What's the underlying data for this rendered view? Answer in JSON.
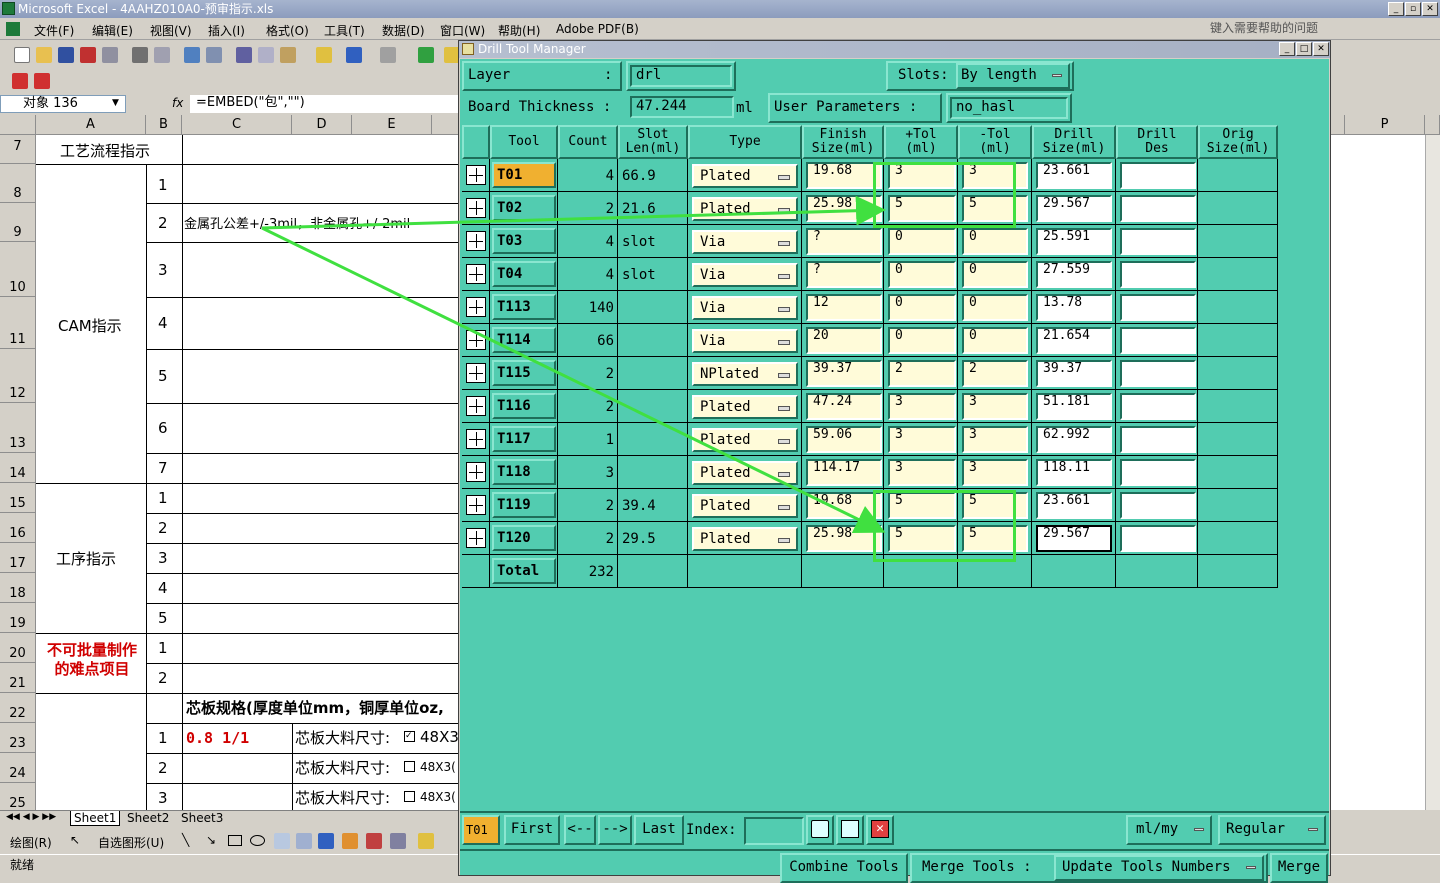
{
  "excel": {
    "window_title": "Microsoft Excel - 4AAHZ010A0-预审指示.xls",
    "menu": [
      "文件(F)",
      "编辑(E)",
      "视图(V)",
      "插入(I)",
      "格式(O)",
      "工具(T)",
      "数据(D)",
      "窗口(W)",
      "帮助(H)",
      "Adobe PDF(B)"
    ],
    "help_placeholder": "键入需要帮助的问题",
    "name_box": "对象 136",
    "fx": "fx",
    "formula": "=EMBED(\"包\",\"\")",
    "columns": [
      "A",
      "B",
      "C",
      "D",
      "E"
    ],
    "right_column": "P",
    "rows": [
      {
        "n": "7"
      },
      {
        "n": "8"
      },
      {
        "n": "9"
      },
      {
        "n": "10"
      },
      {
        "n": "11"
      },
      {
        "n": "12"
      },
      {
        "n": "13"
      },
      {
        "n": "14"
      },
      {
        "n": "15"
      },
      {
        "n": "16"
      },
      {
        "n": "17"
      },
      {
        "n": "18"
      },
      {
        "n": "19"
      },
      {
        "n": "20"
      },
      {
        "n": "21"
      },
      {
        "n": "22"
      },
      {
        "n": "23"
      },
      {
        "n": "24"
      },
      {
        "n": "25"
      }
    ],
    "cells": {
      "process_title": "工艺流程指示",
      "cam": "CAM指示",
      "cam_nums": [
        "1",
        "2",
        "3",
        "4",
        "5",
        "6",
        "7"
      ],
      "cam_row2": "金属孔公差+/-3mil，非金属孔+/-2mil",
      "procedure": "工序指示",
      "proc_nums": [
        "1",
        "2",
        "3",
        "4",
        "5"
      ],
      "nobatch": "不可批量制作的难点项目",
      "nobatch_nums": [
        "1",
        "2"
      ],
      "core_spec": "芯板规格(厚度单位mm，铜厚单位oz,",
      "core_nums": [
        "1",
        "2",
        "3"
      ],
      "core_first": "0.8 1/1",
      "core_size": "芯板大料尺寸:",
      "core_opt1": "48X3",
      "core_opt2": "48X3("
    },
    "sheets": [
      "Sheet1",
      "Sheet2",
      "Sheet3"
    ],
    "draw_label": "绘图(R)",
    "autoshape": "自选图形(U)",
    "status": "就绪"
  },
  "dtm": {
    "title": "Drill Tool Manager",
    "layer_label": "Layer",
    "layer_colon": ":",
    "layer_value": "drl",
    "slots_label": "Slots:",
    "slots_value": "By length",
    "board_thickness_label": "Board Thickness :",
    "board_thickness_value": "47.244",
    "board_thickness_unit": "ml",
    "user_params_label": "User Parameters :",
    "user_params_value": "no_hasl",
    "headers": [
      "Tool",
      "Count",
      "Slot\nLen(ml)",
      "Type",
      "Finish\nSize(ml)",
      "+Tol\n(ml)",
      "-Tol\n(ml)",
      "Drill\nSize(ml)",
      "Drill\nDes",
      "Orig\nSize(ml)"
    ],
    "tools": [
      {
        "tool": "T01",
        "count": "4",
        "slot": "66.9",
        "type": "Plated",
        "finish": "19.68",
        "ptol": "3",
        "mtol": "3",
        "drill": "23.661",
        "des": ""
      },
      {
        "tool": "T02",
        "count": "2",
        "slot": "21.6",
        "type": "Plated",
        "finish": "25.98",
        "ptol": "5",
        "mtol": "5",
        "drill": "29.567",
        "des": ""
      },
      {
        "tool": "T03",
        "count": "4",
        "slot": "slot",
        "type": "Via",
        "finish": "?",
        "ptol": "0",
        "mtol": "0",
        "drill": "25.591",
        "des": ""
      },
      {
        "tool": "T04",
        "count": "4",
        "slot": "slot",
        "type": "Via",
        "finish": "?",
        "ptol": "0",
        "mtol": "0",
        "drill": "27.559",
        "des": ""
      },
      {
        "tool": "T113",
        "count": "140",
        "slot": "",
        "type": "Via",
        "finish": "12",
        "ptol": "0",
        "mtol": "0",
        "drill": "13.78",
        "des": ""
      },
      {
        "tool": "T114",
        "count": "66",
        "slot": "",
        "type": "Via",
        "finish": "20",
        "ptol": "0",
        "mtol": "0",
        "drill": "21.654",
        "des": ""
      },
      {
        "tool": "T115",
        "count": "2",
        "slot": "",
        "type": "NPlated",
        "finish": "39.37",
        "ptol": "2",
        "mtol": "2",
        "drill": "39.37",
        "des": ""
      },
      {
        "tool": "T116",
        "count": "2",
        "slot": "",
        "type": "Plated",
        "finish": "47.24",
        "ptol": "3",
        "mtol": "3",
        "drill": "51.181",
        "des": ""
      },
      {
        "tool": "T117",
        "count": "1",
        "slot": "",
        "type": "Plated",
        "finish": "59.06",
        "ptol": "3",
        "mtol": "3",
        "drill": "62.992",
        "des": ""
      },
      {
        "tool": "T118",
        "count": "3",
        "slot": "",
        "type": "Plated",
        "finish": "114.17",
        "ptol": "3",
        "mtol": "3",
        "drill": "118.11",
        "des": ""
      },
      {
        "tool": "T119",
        "count": "2",
        "slot": "39.4",
        "type": "Plated",
        "finish": "19.68",
        "ptol": "5",
        "mtol": "5",
        "drill": "23.661",
        "des": ""
      },
      {
        "tool": "T120",
        "count": "2",
        "slot": "29.5",
        "type": "Plated",
        "finish": "25.98",
        "ptol": "5",
        "mtol": "5",
        "drill": "29.567",
        "des": ""
      }
    ],
    "total_label": "Total",
    "total_value": "232",
    "nav": {
      "current": "T01",
      "first": "First",
      "prev": "<--",
      "next": "-->",
      "last": "Last",
      "index": "Index:",
      "units": "ml/my",
      "mode": "Regular"
    },
    "actions": {
      "combine": "Combine Tools",
      "merge_label": "Merge Tools :",
      "update": "Update Tools Numbers",
      "merge": "Merge"
    }
  }
}
